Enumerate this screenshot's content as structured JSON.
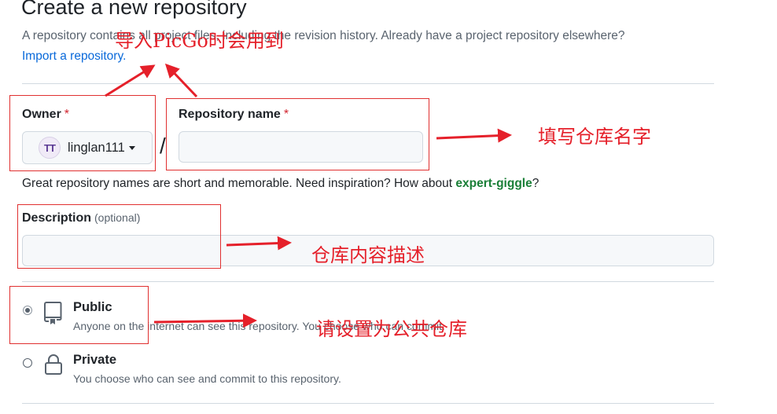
{
  "page": {
    "title": "Create a new repository",
    "subtitle": "A repository contains all project files, including the revision history. Already have a project repository elsewhere?",
    "import_link": "Import a repository."
  },
  "owner": {
    "label": "Owner",
    "required_mark": "*",
    "avatar_text": "TT",
    "value": "linglan111"
  },
  "separator": "/",
  "repo_name": {
    "label": "Repository name",
    "required_mark": "*",
    "value": ""
  },
  "name_hint": {
    "prefix": "Great repository names are short and memorable. Need inspiration? How about ",
    "suggestion": "expert-giggle",
    "suffix": "?"
  },
  "description": {
    "label": "Description",
    "optional": "(optional)",
    "value": ""
  },
  "visibility": {
    "selected": "Public",
    "options": [
      {
        "title": "Public",
        "desc": "Anyone on the internet can see this repository. You choose who can commit.",
        "icon": "repo-icon"
      },
      {
        "title": "Private",
        "desc": "You choose who can see and commit to this repository.",
        "icon": "lock-icon"
      }
    ]
  },
  "annotations": {
    "import_note": "导入PicGo时会用到",
    "name_note": "填写仓库名字",
    "desc_note": "仓库内容描述",
    "public_note": "请设置为公共仓库",
    "color": "#e5202a"
  }
}
